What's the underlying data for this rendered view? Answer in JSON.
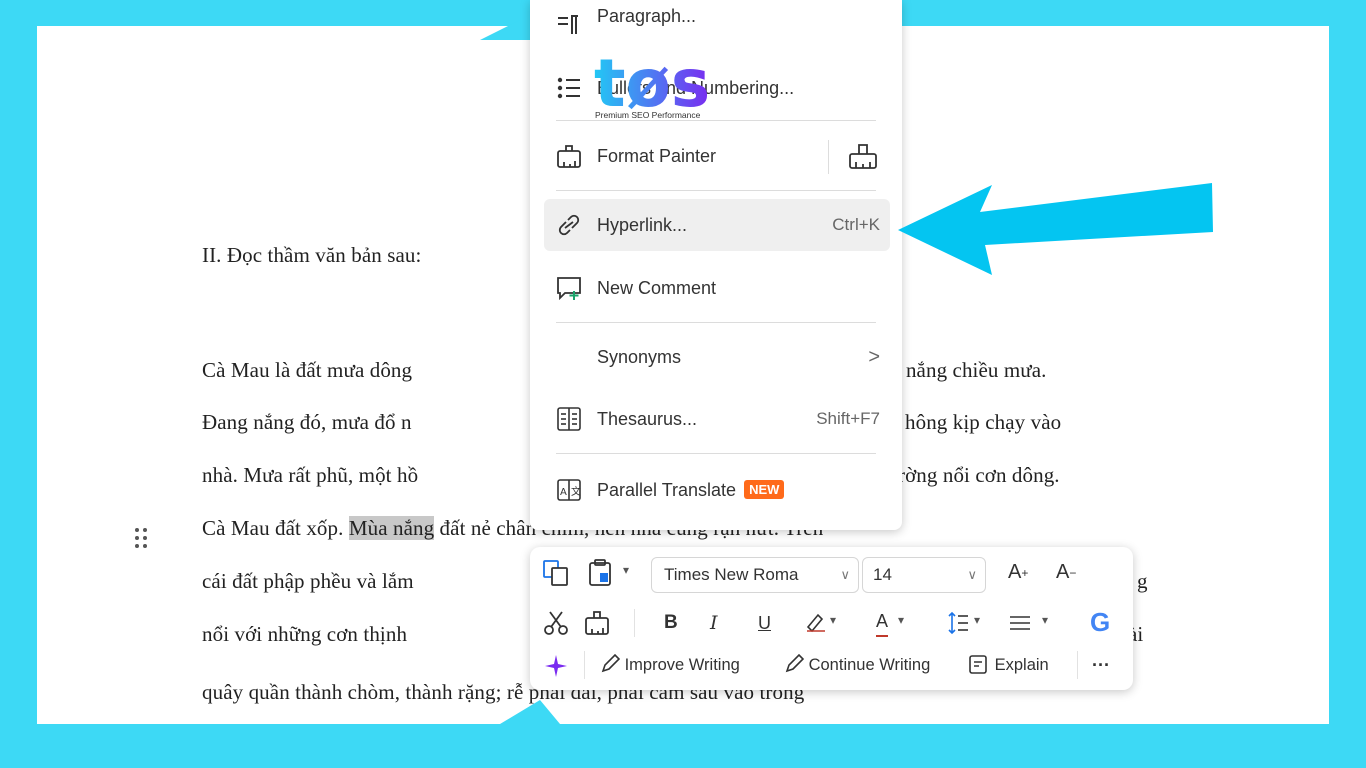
{
  "colors": {
    "background": "#3dd9f5",
    "arrow": "#04c5f1",
    "badge": "#ff6a1a",
    "logo_gradient": [
      "#22c8f4",
      "#7a2bf0"
    ]
  },
  "logo": {
    "text": "tøs",
    "tagline": "Premium SEO Performance"
  },
  "document": {
    "heading": "II. Đọc thầm văn bản sau:",
    "lines": [
      {
        "text": "Cà Mau là đất mưa dông",
        "right": "n nắng chiều mưa."
      },
      {
        "text": "Đang nắng đó, mưa đổ n",
        "right": "hông kịp chạy vào"
      },
      {
        "text": "nhà. Mưa rất phũ, một hồ",
        "right": "rờng nổi cơn dông."
      },
      {
        "text": "Cà Mau đất xốp. ",
        "highlight": "Mùa nắng",
        "tail": " đất nẻ chân chim, nền nhà cũng rạn nứt. Trên"
      },
      {
        "text": "cái đất phập phều và lắm",
        "right": "g"
      },
      {
        "text": "nổi với những cơn thịnh",
        "right": "ài"
      },
      {
        "text": "quây quần thành chòm, thành rặng; rễ phải dài, phải cắm sâu vào trong"
      }
    ]
  },
  "context_menu": {
    "items": [
      {
        "label": "Paragraph...",
        "icon": "paragraph-icon"
      },
      {
        "label": "Bullets and Numbering...",
        "icon": "bullet-list-icon"
      },
      {
        "label": "Format Painter",
        "icon": "format-painter-icon"
      },
      {
        "label": "Hyperlink...",
        "shortcut": "Ctrl+K",
        "icon": "link-icon"
      },
      {
        "label": "New Comment",
        "icon": "comment-plus-icon"
      },
      {
        "label": "Synonyms",
        "icon": "chevron-right-icon"
      },
      {
        "label": "Thesaurus...",
        "shortcut": "Shift+F7",
        "icon": "thesaurus-icon"
      },
      {
        "label": "Parallel Translate",
        "badge": "NEW",
        "icon": "translate-icon"
      }
    ]
  },
  "toolbar": {
    "font_name": "Times New Roma",
    "font_size": "14",
    "grow_label": "A",
    "grow_sup": "+",
    "shrink_label": "A",
    "shrink_sup": "−",
    "bold": "B",
    "italic": "I",
    "underline": "U",
    "font_color": "A",
    "google": "G",
    "ai_actions": [
      "Improve Writing",
      "Continue Writing",
      "Explain"
    ],
    "more": "···"
  }
}
